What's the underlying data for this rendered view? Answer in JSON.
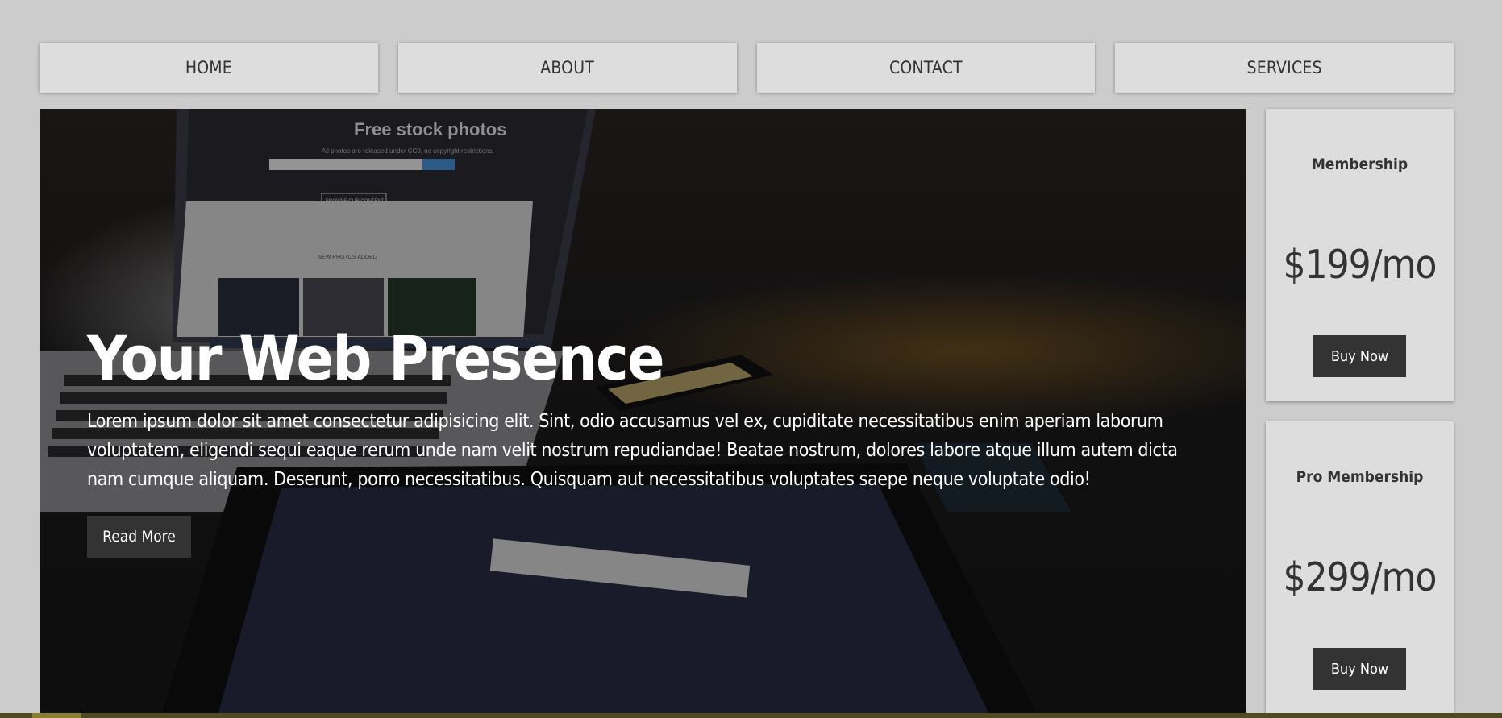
{
  "nav": {
    "items": [
      {
        "label": "HOME"
      },
      {
        "label": "ABOUT"
      },
      {
        "label": "CONTACT"
      },
      {
        "label": "SERVICES"
      }
    ]
  },
  "hero": {
    "title": "Your Web Presence",
    "text": "Lorem ipsum dolor sit amet consectetur adipisicing elit. Sint, odio accusamus vel ex, cupiditate necessitatibus enim aperiam laborum voluptatem, eligendi sequi eaque rerum unde nam velit nostrum repudiandae! Beatae nostrum, dolores labore atque illum autem dicta nam cumque aliquam. Deserunt, porro necessitatibus. Quisquam aut necessitatibus voluptates saepe neque voluptate odio!",
    "button_label": "Read More",
    "image_text": {
      "screen_title": "Free stock photos",
      "screen_subtitle": "All photos are released under CC0, no copyright restrictions.",
      "screen_button": "BROWSE OUR CONTENT",
      "screen_section": "NEW PHOTOS ADDED"
    }
  },
  "plans": [
    {
      "name": "Membership",
      "price": "$199/mo",
      "button_label": "Buy Now"
    },
    {
      "name": "Pro Membership",
      "price": "$299/mo",
      "button_label": "Buy Now"
    }
  ],
  "colors": {
    "page_background": "#cccccc",
    "panel": "#dddddd",
    "button": "#333333",
    "text": "#333333",
    "hero_text": "#ffffff"
  }
}
